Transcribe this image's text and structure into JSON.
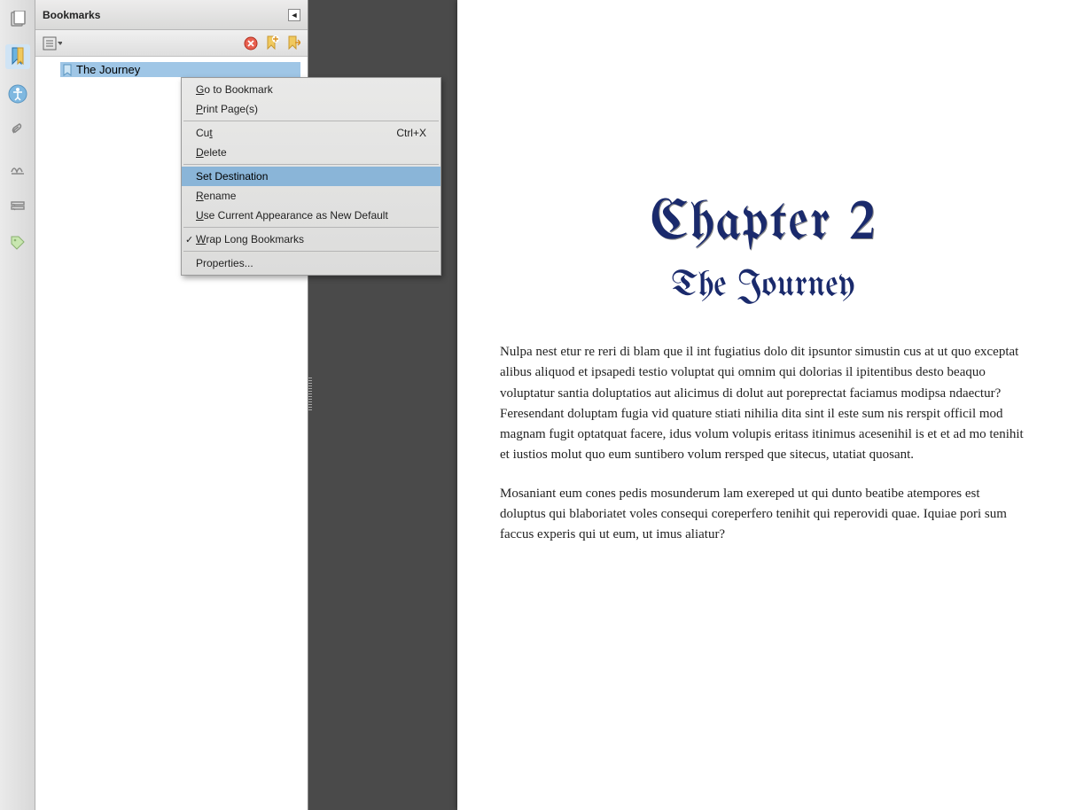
{
  "panel": {
    "title": "Bookmarks",
    "bookmark": "The Journey"
  },
  "context_menu": {
    "go_to": "Go to Bookmark",
    "print": "Print Page(s)",
    "cut": "Cut",
    "cut_shortcut": "Ctrl+X",
    "delete": "Delete",
    "set_dest": "Set Destination",
    "rename": "Rename",
    "use_appearance": "Use Current Appearance as New Default",
    "wrap": "Wrap Long Bookmarks",
    "properties": "Properties..."
  },
  "document": {
    "chapter_title": "Chapter 2",
    "chapter_subtitle": "The Journey",
    "para1": "Nulpa nest etur re reri di blam que il int fugiatius dolo dit ipsuntor simustin cus at ut quo exceptat alibus aliquod et ipsapedi testio voluptat qui omnim qui dolorias il ipitentibus desto beaquo voluptatur santia doluptatios aut alicimus di dolut aut poreprectat faciamus modipsa ndaectur? Feresendant doluptam fugia vid quature stiati nihilia dita sint il este sum nis rerspit officil mod magnam fugit optatquat facere, idus volum volupis eritass itinimus acesenihil is et et ad mo tenihit et iustios molut quo eum suntibero volum rersped que sitecus, utatiat quosant.",
    "para2": "Mosaniant eum cones pedis mosunderum lam exereped ut qui dunto beatibe atempores est doluptus qui blaboriatet voles consequi coreperfero tenihit qui reperovidi quae. Iquiae pori sum faccus experis qui ut eum, ut imus aliatur?"
  }
}
